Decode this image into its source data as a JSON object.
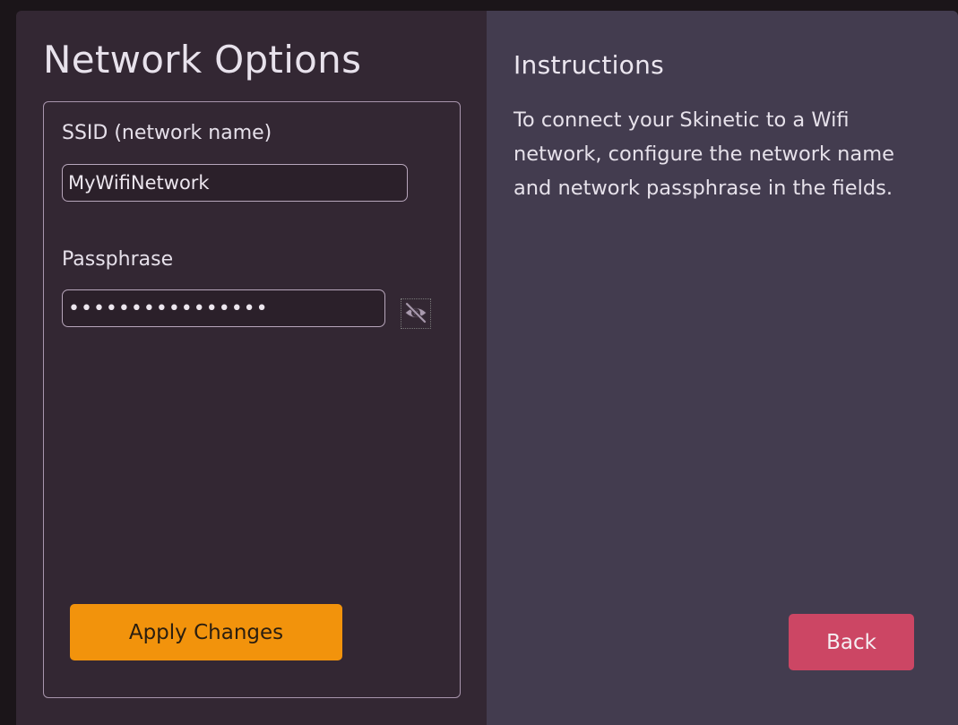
{
  "network_options": {
    "title": "Network Options",
    "ssid": {
      "label": "SSID (network name)",
      "value": "MyWifiNetwork"
    },
    "passphrase": {
      "label": "Passphrase",
      "value": "••••••••••••••••",
      "toggle_icon": "eye-slash-icon"
    },
    "apply_label": "Apply Changes"
  },
  "instructions": {
    "title": "Instructions",
    "text": "To connect your Skinetic to a Wifi network, configure the network name and network passphrase in the fields."
  },
  "back_label": "Back",
  "colors": {
    "apply_button": "#f2930c",
    "back_button": "#cc4664",
    "left_panel": "#332733",
    "right_panel": "#433c4f"
  }
}
